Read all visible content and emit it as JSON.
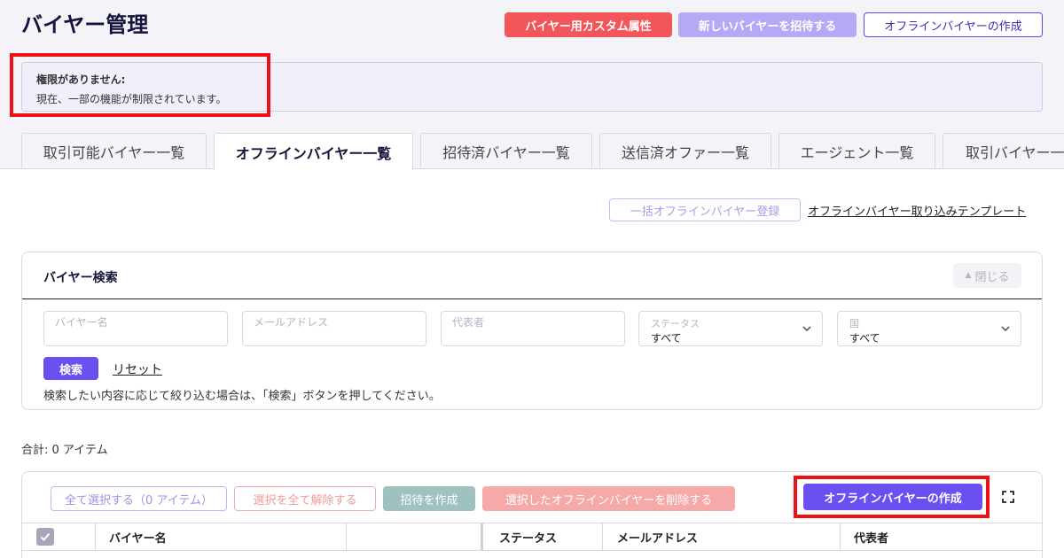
{
  "header": {
    "title": "バイヤー管理",
    "custom_attr_label": "バイヤー用カスタム属性",
    "invite_label": "新しいバイヤーを招待する",
    "create_offline_label": "オフラインバイヤーの作成"
  },
  "notice": {
    "title": "権限がありません:",
    "body": "現在、一部の機能が制限されています。"
  },
  "tabs": [
    {
      "label": "取引可能バイヤー一覧",
      "active": false
    },
    {
      "label": "オフラインバイヤー一覧",
      "active": true
    },
    {
      "label": "招待済バイヤー一覧",
      "active": false
    },
    {
      "label": "送信済オファー一覧",
      "active": false
    },
    {
      "label": "エージェント一覧",
      "active": false
    },
    {
      "label": "取引バイヤー一",
      "active": false
    }
  ],
  "actions": {
    "bulk_register_label": "一括オフラインバイヤー登録",
    "template_link_label": "オフラインバイヤー取り込みテンプレート"
  },
  "search": {
    "title": "バイヤー検索",
    "close_label": "閉じる",
    "buyer_name_placeholder": "バイヤー名",
    "email_placeholder": "メールアドレス",
    "representative_placeholder": "代表者",
    "status_label": "ステータス",
    "status_value": "すべて",
    "country_label": "国",
    "country_value": "すべて",
    "search_button": "検索",
    "reset_link": "リセット",
    "hint": "検索したい内容に応じて絞り込む場合は、「検索」ボタンを押してください。"
  },
  "summary": {
    "total": "合計:  0 アイテム"
  },
  "table": {
    "select_all_label": "全て選択する（0 アイテム）",
    "deselect_all_label": "選択を全て解除する",
    "create_invite_label": "招待を作成",
    "delete_selected_label": "選択したオフラインバイヤーを削除する",
    "create_offline_label": "オフラインバイヤーの作成",
    "columns": {
      "buyer_name": "バイヤー名",
      "status": "ステータス",
      "email": "メールアドレス",
      "representative": "代表者"
    }
  },
  "colors": {
    "brand_purple": "#6b4ff0",
    "danger_red": "#f2555a",
    "highlight_red": "#ee1111"
  }
}
